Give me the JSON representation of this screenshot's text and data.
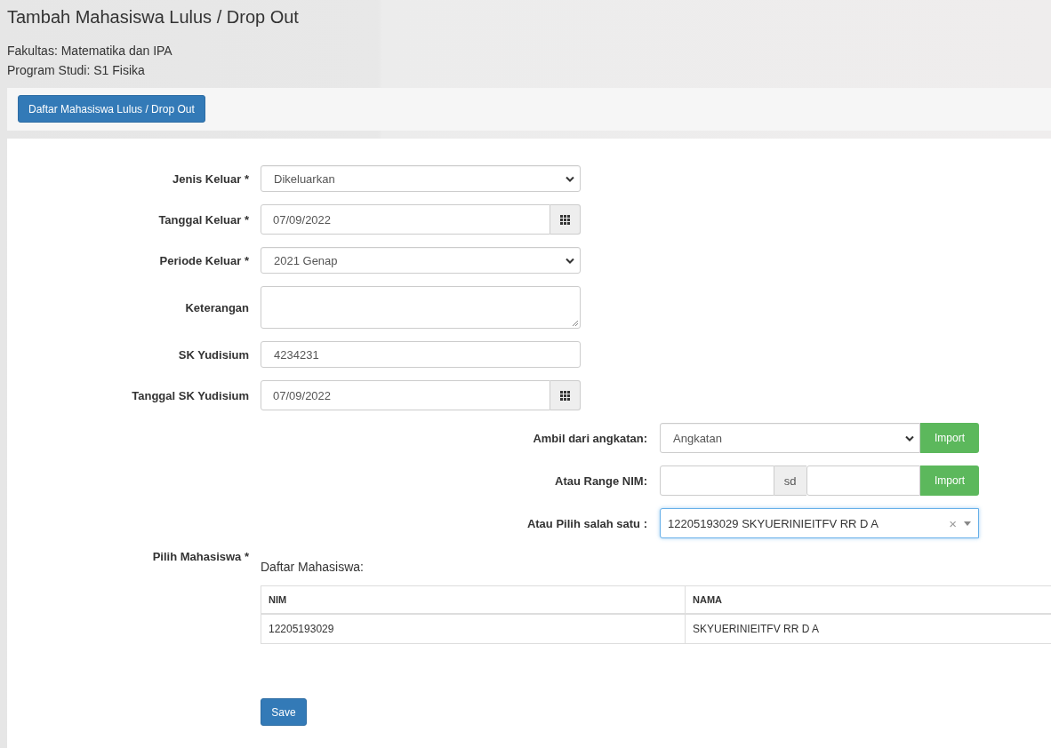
{
  "header": {
    "title": "Tambah Mahasiswa Lulus / Drop Out",
    "faculty": "Fakultas: Matematika dan IPA",
    "program": "Program Studi: S1 Fisika"
  },
  "toolbar": {
    "button": "Daftar Mahasiswa Lulus / Drop Out"
  },
  "form": {
    "fields": [
      {
        "kind": "select",
        "label": "Jenis Keluar *",
        "value": "Dikeluarkan"
      },
      {
        "kind": "date",
        "label": "Tanggal Keluar *",
        "value": "07/09/2022"
      },
      {
        "kind": "select",
        "label": "Periode Keluar *",
        "value": "2021 Genap"
      },
      {
        "kind": "textarea",
        "label": "Keterangan"
      },
      {
        "kind": "text",
        "label": "SK Yudisium",
        "value": "4234231"
      },
      {
        "kind": "date",
        "label": "Tanggal SK Yudisium",
        "value": "07/09/2022"
      }
    ],
    "import": [
      {
        "kind": "select",
        "label": "Ambil dari angkatan:",
        "value": "Angkatan",
        "button": "Import"
      },
      {
        "kind": "range",
        "label": "Atau Range NIM:",
        "separator": "sd",
        "button": "Import"
      },
      {
        "kind": "combo",
        "label": "Atau Pilih salah satu :",
        "value": "12205193029 SKYUERINIEITFV RR D A",
        "clear": "×"
      }
    ],
    "students": {
      "label": "Pilih Mahasiswa *",
      "list_title": "Daftar Mahasiswa:",
      "columns": [
        "NIM",
        "NAMA"
      ],
      "rows": [
        [
          "12205193029",
          "SKYUERINIEITFV RR D A"
        ]
      ]
    },
    "save_button": "Save"
  }
}
